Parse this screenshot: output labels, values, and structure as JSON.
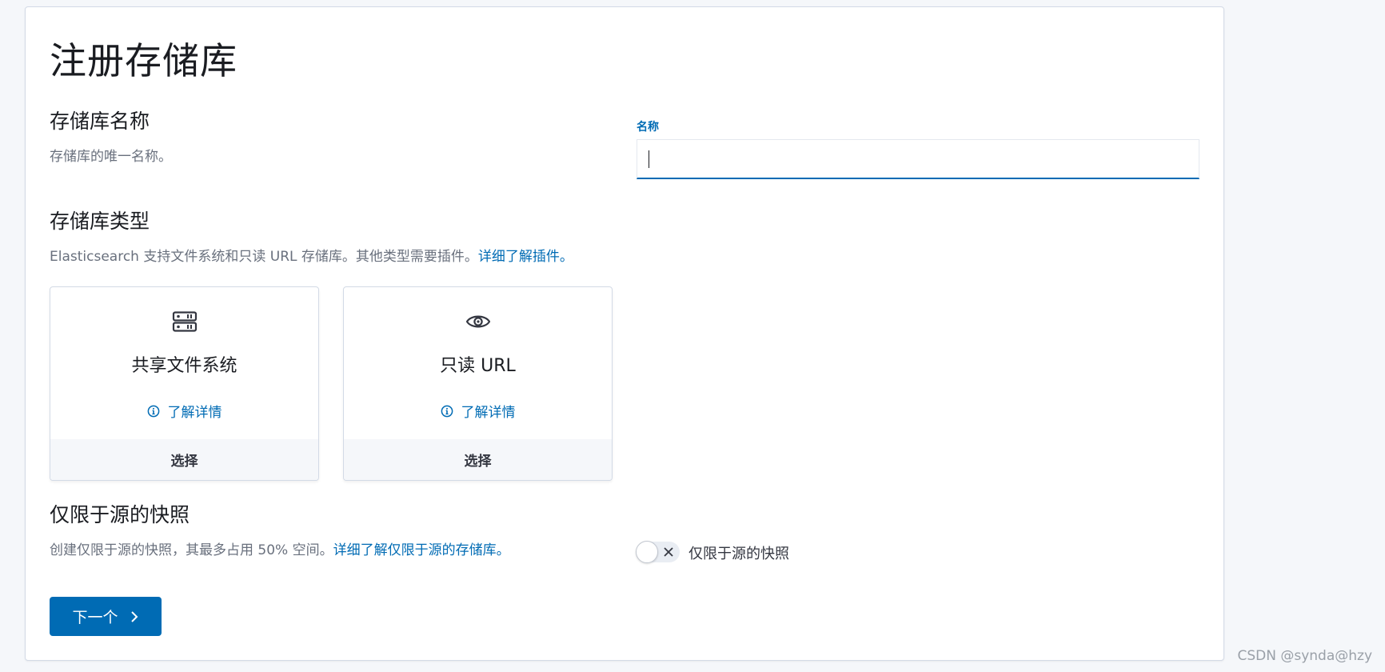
{
  "page": {
    "title": "注册存储库"
  },
  "repo_name": {
    "title": "存储库名称",
    "description": "存储库的唯一名称。",
    "field_label": "名称",
    "input_value": ""
  },
  "repo_type": {
    "title": "存储库类型",
    "description": "Elasticsearch 支持文件系统和只读 URL 存储库。其他类型需要插件。",
    "link": "详细了解插件。",
    "cards": [
      {
        "title": "共享文件系统",
        "icon": "storage-icon",
        "learn_more": "了解详情",
        "select": "选择"
      },
      {
        "title": "只读 URL",
        "icon": "eye-icon",
        "learn_more": "了解详情",
        "select": "选择"
      }
    ]
  },
  "source_only": {
    "title": "仅限于源的快照",
    "description": "创建仅限于源的快照，其最多占用 50% 空间。",
    "link": "详细了解仅限于源的存储库。",
    "toggle_label": "仅限于源的快照",
    "toggle_on": false
  },
  "next_button": {
    "label": "下一个"
  },
  "watermark": "CSDN @synda@hzy",
  "colors": {
    "accent": "#006bb4",
    "text": "#343741",
    "muted": "#69707d",
    "background": "#f5f7fa"
  }
}
